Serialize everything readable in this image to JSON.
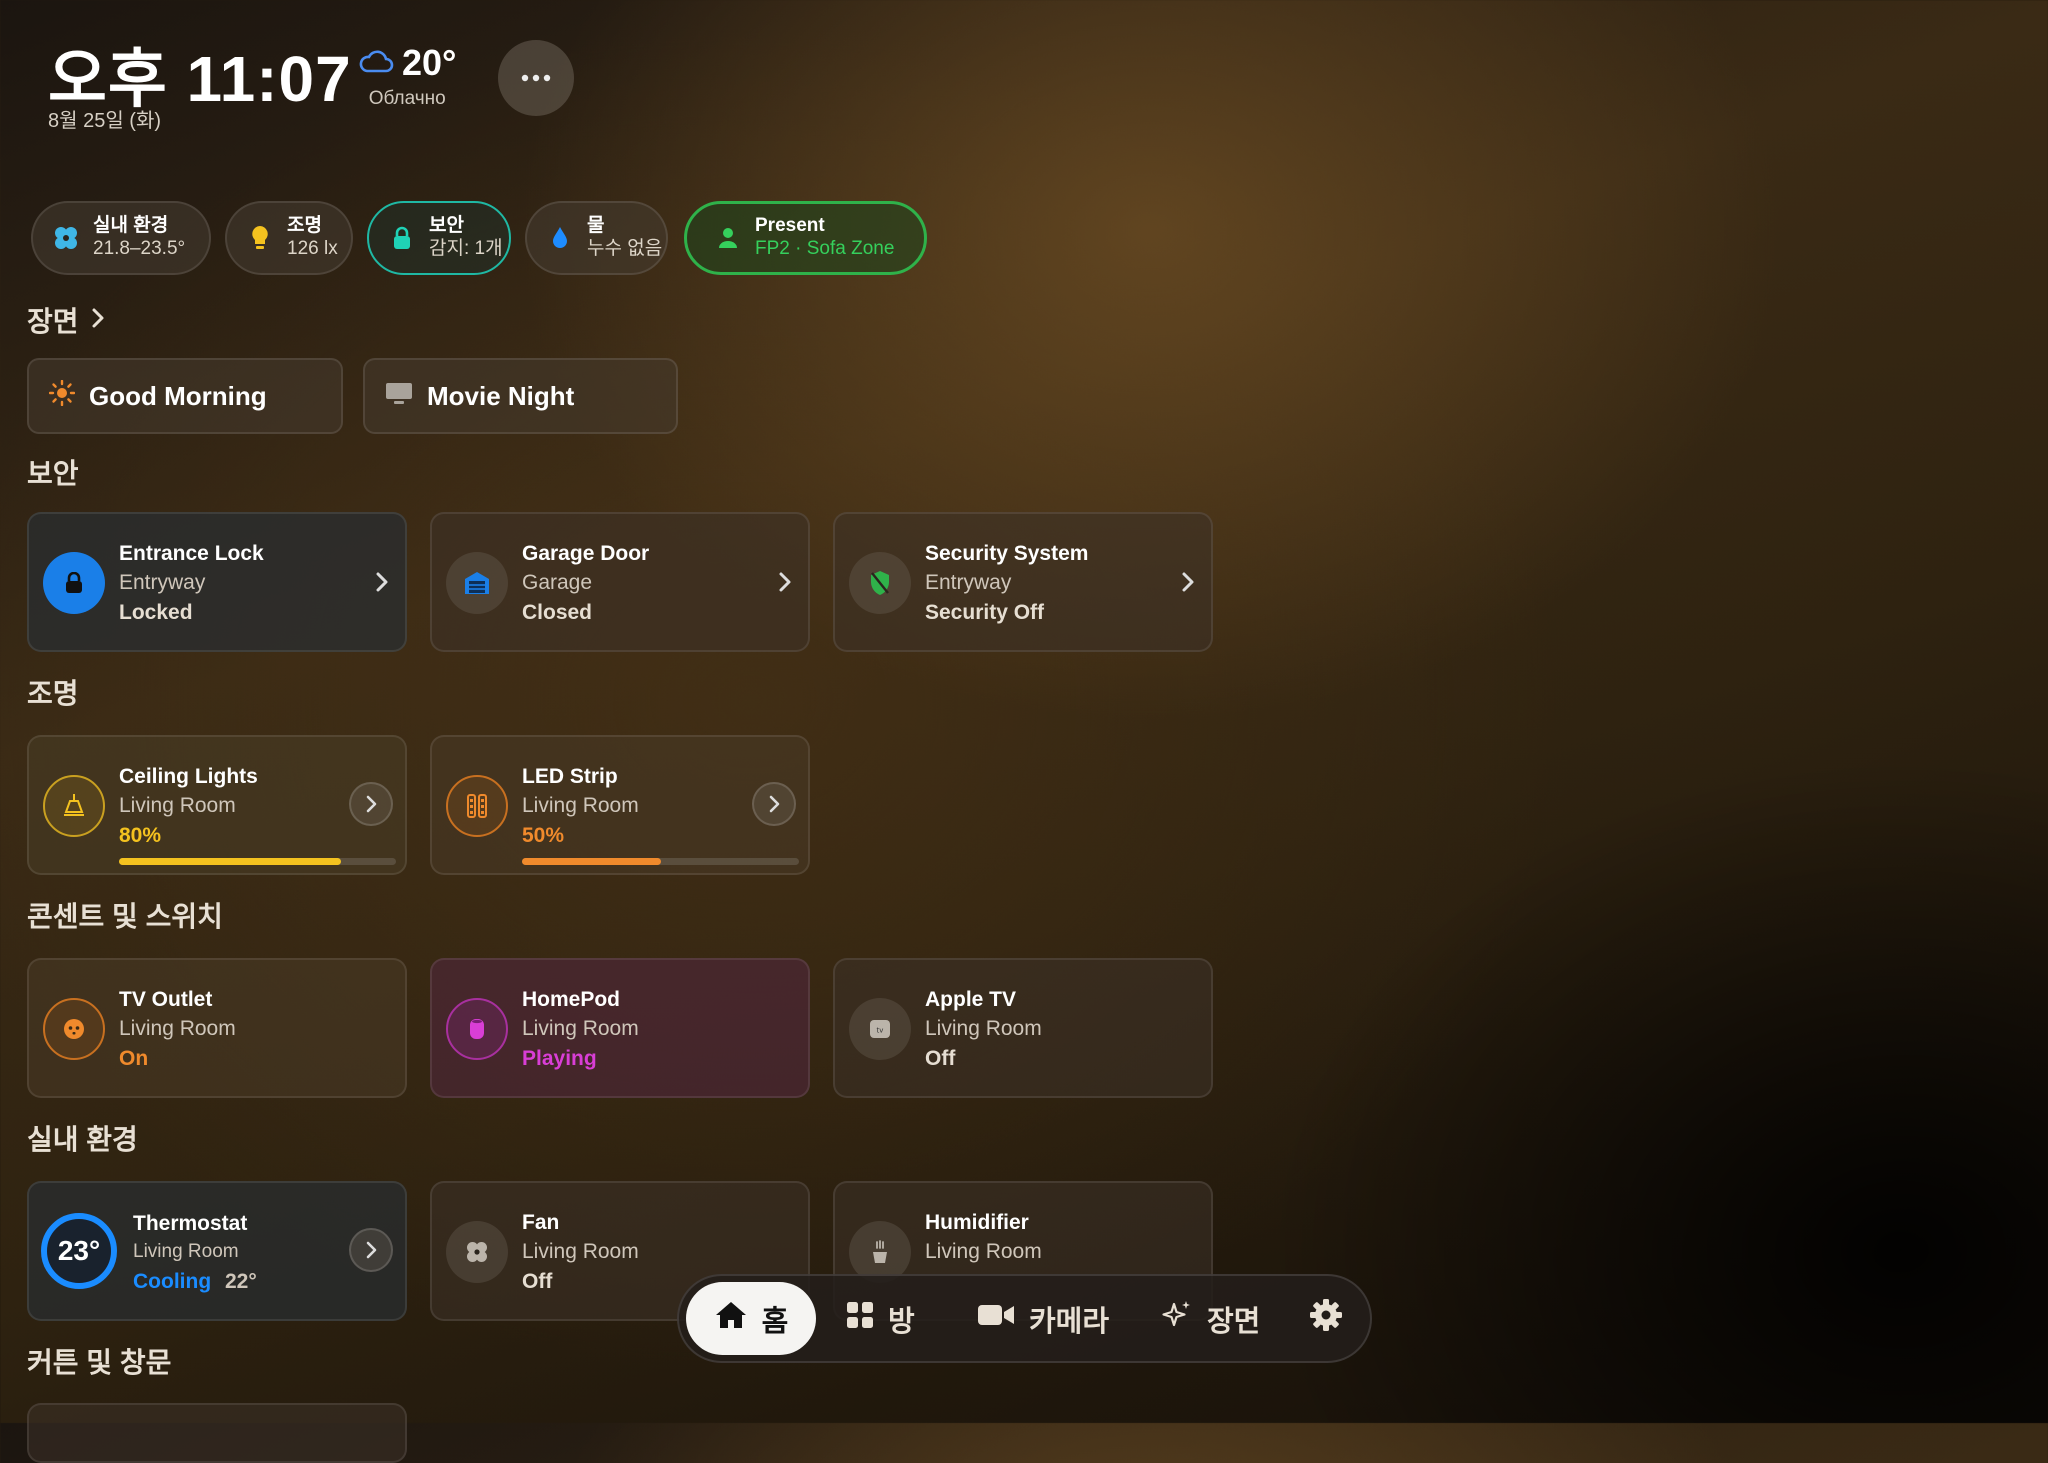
{
  "header": {
    "time": "오후 11:07",
    "date": "8월 25일 (화)",
    "weather": {
      "temp": "20°",
      "condition": "Облачно",
      "icon": "cloud-icon"
    },
    "more_icon": "ellipsis-icon"
  },
  "chips": [
    {
      "title": "실내 환경",
      "value": "21.8–23.5°",
      "icon": "fan-icon",
      "color": "#3fb6e6"
    },
    {
      "title": "조명",
      "value": "126 lx",
      "icon": "lightbulb-icon",
      "color": "#f4c21f"
    },
    {
      "title": "보안",
      "value": "감지: 1개",
      "icon": "lock-icon",
      "color": "#1fd2b6"
    },
    {
      "title": "물",
      "value": "누수 없음",
      "icon": "water-drop-icon",
      "color": "#1e8cff"
    },
    {
      "title": "Present",
      "value": "FP2 · Sofa Zone",
      "icon": "person-icon",
      "color": "#35d05c"
    }
  ],
  "scenes": {
    "header": "장면",
    "items": [
      {
        "label": "Good Morning",
        "icon": "sun-icon"
      },
      {
        "label": "Movie Night",
        "icon": "tv-icon"
      }
    ]
  },
  "security": {
    "header": "보안",
    "items": [
      {
        "name": "Entrance Lock",
        "room": "Entryway",
        "status": "Locked",
        "icon": "lock-icon"
      },
      {
        "name": "Garage Door",
        "room": "Garage",
        "status": "Closed",
        "icon": "garage-door-icon"
      },
      {
        "name": "Security System",
        "room": "Entryway",
        "status": "Security Off",
        "icon": "shield-icon"
      }
    ]
  },
  "lighting": {
    "header": "조명",
    "items": [
      {
        "name": "Ceiling Lights",
        "room": "Living Room",
        "status": "80%",
        "level": 0.8,
        "icon": "ceiling-light-icon",
        "color": "#f4c21f"
      },
      {
        "name": "LED Strip",
        "room": "Living Room",
        "status": "50%",
        "level": 0.5,
        "icon": "led-strip-icon",
        "color": "#f08a2c"
      }
    ]
  },
  "outlets": {
    "header": "콘센트 및 스위치",
    "items": [
      {
        "name": "TV Outlet",
        "room": "Living Room",
        "status": "On",
        "icon": "outlet-icon",
        "color": "#f08a2c"
      },
      {
        "name": "HomePod",
        "room": "Living Room",
        "status": "Playing",
        "icon": "homepod-icon",
        "color": "#d93ed6"
      },
      {
        "name": "Apple TV",
        "room": "Living Room",
        "status": "Off",
        "icon": "apple-tv-icon",
        "color": "#e6ded2"
      }
    ]
  },
  "climate": {
    "header": "실내 환경",
    "items": [
      {
        "name": "Thermostat",
        "room": "Living Room",
        "current": "23°",
        "mode": "Cooling",
        "target": "22°",
        "icon": "thermostat-ring-icon"
      },
      {
        "name": "Fan",
        "room": "Living Room",
        "status": "Off",
        "icon": "fan-icon"
      },
      {
        "name": "Humidifier",
        "room": "Living Room",
        "icon": "humidifier-icon"
      }
    ]
  },
  "curtains": {
    "header": "커튼 및 창문"
  },
  "nav": {
    "items": [
      {
        "label": "홈",
        "icon": "house-icon"
      },
      {
        "label": "방",
        "icon": "grid-icon"
      },
      {
        "label": "카메라",
        "icon": "video-camera-icon"
      },
      {
        "label": "장면",
        "icon": "sparkles-icon"
      }
    ],
    "settings_icon": "gear-icon"
  }
}
